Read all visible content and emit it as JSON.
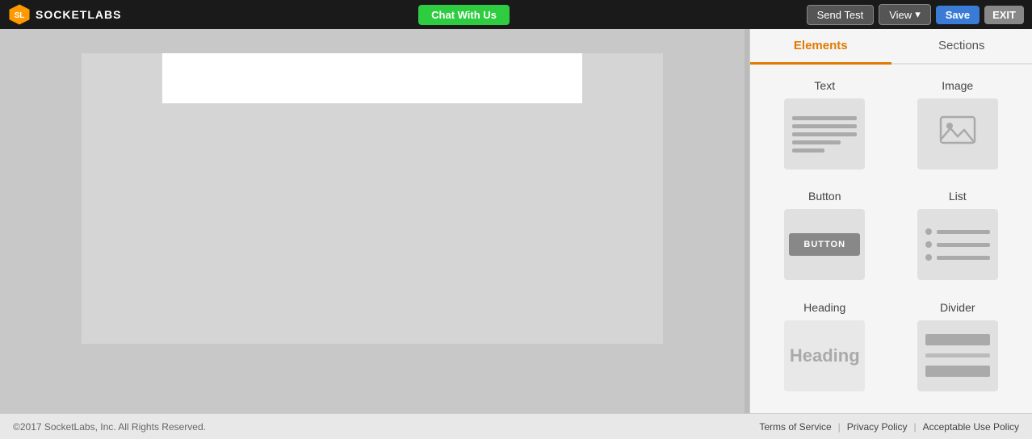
{
  "header": {
    "logo_text": "SOCKETLABS",
    "chat_btn": "Chat With Us",
    "send_test_btn": "Send Test",
    "view_btn": "View",
    "save_btn": "Save",
    "exit_btn": "EXIT"
  },
  "panel": {
    "tab_elements": "Elements",
    "tab_sections": "Sections",
    "elements": [
      {
        "id": "text",
        "label": "Text"
      },
      {
        "id": "image",
        "label": "Image"
      },
      {
        "id": "button",
        "label": "Button"
      },
      {
        "id": "list",
        "label": "List"
      },
      {
        "id": "heading",
        "label": "Heading"
      },
      {
        "id": "divider",
        "label": "Divider"
      }
    ]
  },
  "footer": {
    "copyright": "©2017 SocketLabs, Inc. All Rights Reserved.",
    "link1": "Terms of Service",
    "sep1": "|",
    "link2": "Privacy Policy",
    "sep2": "|",
    "link3": "Acceptable Use Policy"
  }
}
